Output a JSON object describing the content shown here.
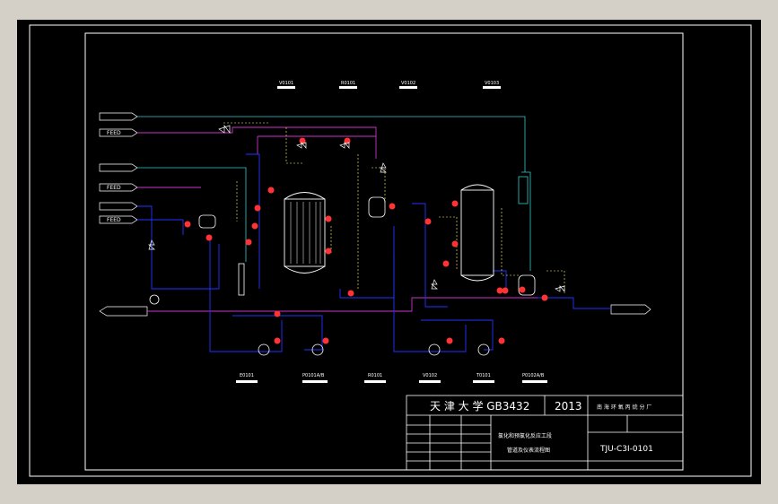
{
  "colors": {
    "background": "#000000",
    "frame": "#ffffff",
    "process_line": "#2233ff",
    "utility_line": "#cc33cc",
    "vent_line": "#33cccc",
    "signal_line": "#ffff66",
    "instrument": "#ff3333",
    "outer": "#d4d0c8"
  },
  "equipment_top_tags": [
    {
      "tag": "V0101"
    },
    {
      "tag": "R0101"
    },
    {
      "tag": "V0102"
    },
    {
      "tag": "V0103"
    }
  ],
  "equipment_bottom_tags": [
    {
      "tag": "E0101"
    },
    {
      "tag": "P0101A/B"
    },
    {
      "tag": "R0101"
    },
    {
      "tag": "V0102"
    },
    {
      "tag": "T0101"
    },
    {
      "tag": "P0102A/B"
    }
  ],
  "feed_labels": [
    "FEED",
    "FEED",
    "FEED"
  ],
  "title_block": {
    "school": "天 津 大 学 GB3432",
    "year": "2013",
    "company": "南 海 环 氧 丙 烷 分 厂",
    "drawing_title_1": "氯化和预氯化反应工段",
    "drawing_title_2": "管道及仪表流程图",
    "drawing_no": "TJU-C3I-0101"
  }
}
